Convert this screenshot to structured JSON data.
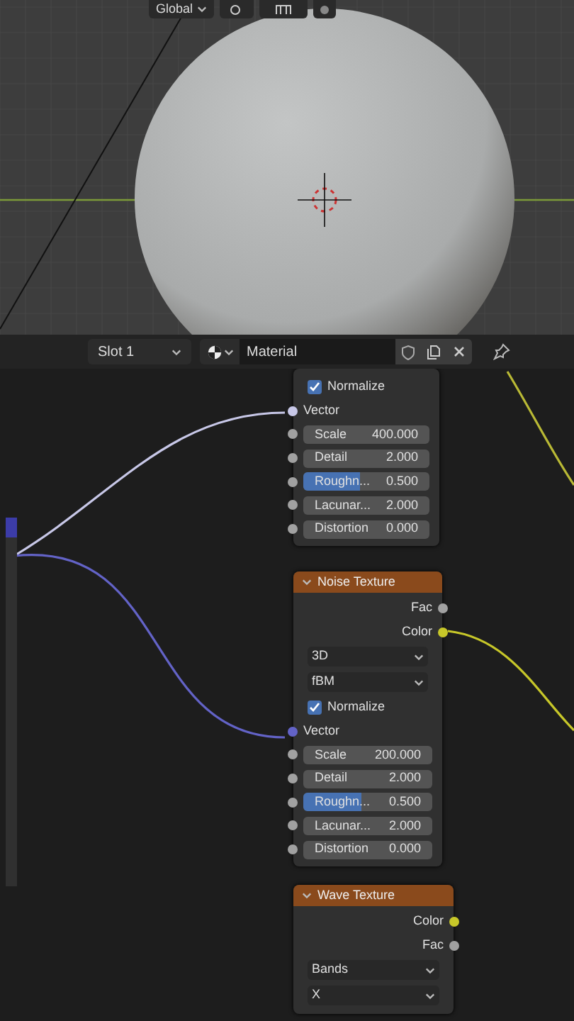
{
  "viewport_toolbar": {
    "transform": "Global"
  },
  "header": {
    "slot": "Slot 1",
    "material": "Material"
  },
  "nodes": [
    {
      "items": [
        {
          "kind": "checkbox",
          "label": "Normalize",
          "checked": true
        },
        {
          "kind": "input",
          "label": "Vector",
          "color": "#c8c8e8"
        },
        {
          "kind": "number",
          "label": "Scale",
          "value": "400.000"
        },
        {
          "kind": "number",
          "label": "Detail",
          "value": "2.000"
        },
        {
          "kind": "slider",
          "label": "Roughn...",
          "value": "0.500",
          "level": 0.45
        },
        {
          "kind": "number",
          "label": "Lacunar...",
          "value": "2.000"
        },
        {
          "kind": "number",
          "label": "Distortion",
          "value": "0.000"
        }
      ]
    },
    {
      "title": "Noise Texture",
      "items": [
        {
          "kind": "output",
          "label": "Fac",
          "color": "#a1a1a1"
        },
        {
          "kind": "output",
          "label": "Color",
          "color": "#c7c729"
        },
        {
          "kind": "dropdown",
          "label": "3D"
        },
        {
          "kind": "dropdown",
          "label": "fBM"
        },
        {
          "kind": "checkbox",
          "label": "Normalize",
          "checked": true
        },
        {
          "kind": "input",
          "label": "Vector",
          "color": "#6363c7"
        },
        {
          "kind": "number",
          "label": "Scale",
          "value": "200.000"
        },
        {
          "kind": "number",
          "label": "Detail",
          "value": "2.000"
        },
        {
          "kind": "slider",
          "label": "Roughn...",
          "value": "0.500",
          "level": 0.45
        },
        {
          "kind": "number",
          "label": "Lacunar...",
          "value": "2.000"
        },
        {
          "kind": "number",
          "label": "Distortion",
          "value": "0.000"
        }
      ]
    },
    {
      "title": "Wave Texture",
      "items": [
        {
          "kind": "output",
          "label": "Color",
          "color": "#c7c729"
        },
        {
          "kind": "output",
          "label": "Fac",
          "color": "#a1a1a1"
        },
        {
          "kind": "dropdown",
          "label": "Bands"
        },
        {
          "kind": "dropdown",
          "label": "X"
        }
      ]
    }
  ]
}
